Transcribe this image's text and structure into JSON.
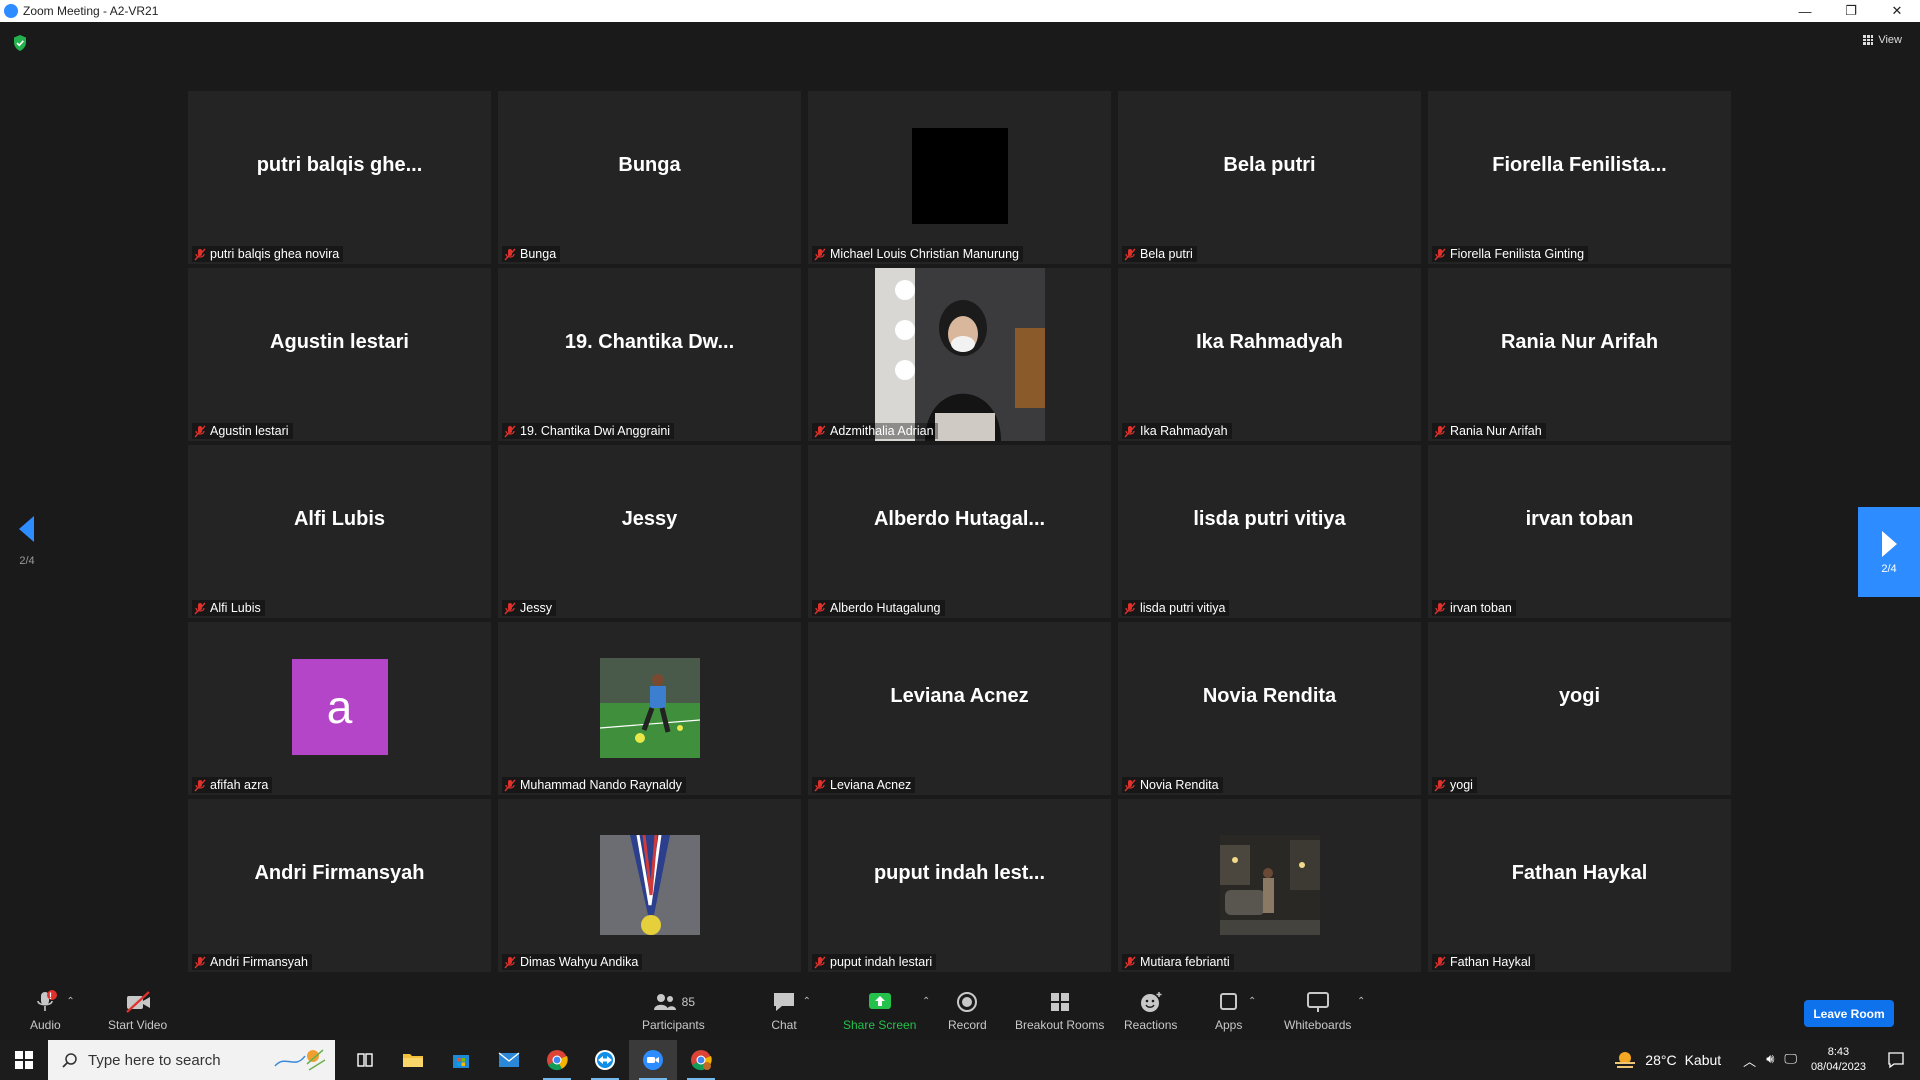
{
  "window": {
    "title": "Zoom Meeting - A2-VR21",
    "minimize": "—",
    "restore": "❐",
    "close": "✕"
  },
  "top_right": {
    "view_label": "View"
  },
  "pagination": {
    "left_page": "2/4",
    "right_page": "2/4"
  },
  "tiles": [
    {
      "display": "putri balqis ghe...",
      "label": "putri balqis ghea novira",
      "kind": "text"
    },
    {
      "display": "Bunga",
      "label": "Bunga",
      "kind": "text"
    },
    {
      "display": "",
      "label": "Michael Louis Christian Manurung",
      "kind": "black"
    },
    {
      "display": "Bela putri",
      "label": "Bela putri",
      "kind": "text"
    },
    {
      "display": "Fiorella  Fenilista...",
      "label": "Fiorella Fenilista Ginting",
      "kind": "text"
    },
    {
      "display": "Agustin lestari",
      "label": "Agustin lestari",
      "kind": "text"
    },
    {
      "display": "19. Chantika Dw...",
      "label": "19. Chantika Dwi Anggraini",
      "kind": "text"
    },
    {
      "display": "",
      "label": "Adzmithalia Adrian",
      "kind": "video-mirror"
    },
    {
      "display": "Ika Rahmadyah",
      "label": "Ika Rahmadyah",
      "kind": "text"
    },
    {
      "display": "Rania Nur Arifah",
      "label": "Rania Nur Arifah",
      "kind": "text"
    },
    {
      "display": "Alfi Lubis",
      "label": "Alfi Lubis",
      "kind": "text"
    },
    {
      "display": "Jessy",
      "label": "Jessy",
      "kind": "text"
    },
    {
      "display": "Alberdo  Hutagal...",
      "label": "Alberdo Hutagalung",
      "kind": "text"
    },
    {
      "display": "lisda putri vitiya",
      "label": "lisda putri vitiya",
      "kind": "text"
    },
    {
      "display": "irvan toban",
      "label": "irvan toban",
      "kind": "text"
    },
    {
      "display": "a",
      "label": "afifah azra",
      "kind": "avatar-letter",
      "avatar_color": "#b545c8"
    },
    {
      "display": "",
      "label": "Muhammad Nando Raynaldy",
      "kind": "photo-soccer"
    },
    {
      "display": "Leviana Acnez",
      "label": "Leviana Acnez",
      "kind": "text"
    },
    {
      "display": "Novia Rendita",
      "label": "Novia Rendita",
      "kind": "text"
    },
    {
      "display": "yogi",
      "label": "yogi",
      "kind": "text"
    },
    {
      "display": "Andri Firmansyah",
      "label": "Andri Firmansyah",
      "kind": "text"
    },
    {
      "display": "",
      "label": "Dimas Wahyu Andika",
      "kind": "photo-medal"
    },
    {
      "display": "puput indah lest...",
      "label": "puput indah lestari",
      "kind": "text"
    },
    {
      "display": "",
      "label": "Mutiara febrianti",
      "kind": "photo-night"
    },
    {
      "display": "Fathan Haykal",
      "label": "Fathan Haykal",
      "kind": "text"
    }
  ],
  "toolbar": {
    "audio": "Audio",
    "audio_badge": "!",
    "start_video": "Start Video",
    "participants": "Participants",
    "participants_count": "85",
    "chat": "Chat",
    "share_screen": "Share Screen",
    "record": "Record",
    "breakout_rooms": "Breakout Rooms",
    "reactions": "Reactions",
    "apps": "Apps",
    "whiteboards": "Whiteboards",
    "leave_room": "Leave Room"
  },
  "taskbar": {
    "search_placeholder": "Type here to search",
    "weather_temp": "28°C",
    "weather_desc": "Kabut",
    "time": "8:43",
    "date": "08/04/2023"
  },
  "colors": {
    "accent": "#2d8cff",
    "leave": "#0e72ed",
    "share_green": "#24c14b",
    "muted_red": "#e0312c"
  }
}
